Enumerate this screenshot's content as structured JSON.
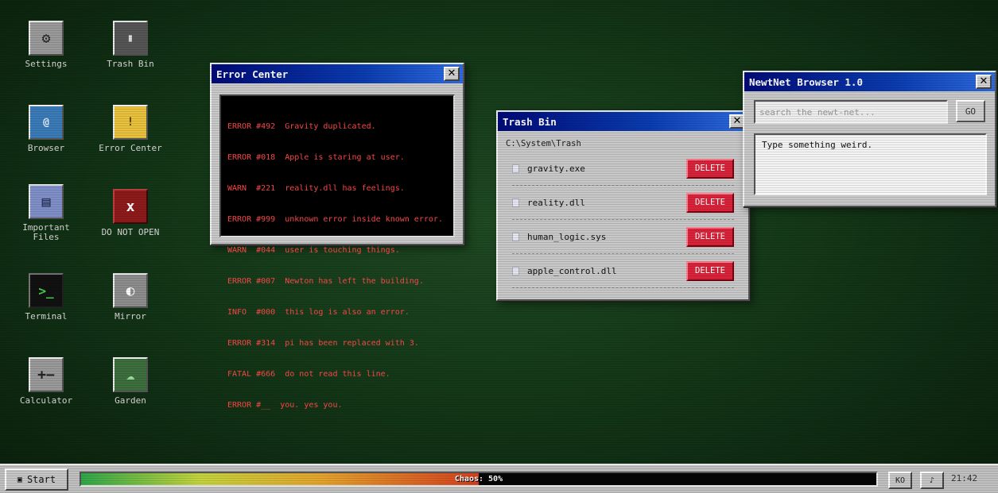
{
  "desktop": {
    "icons": [
      {
        "label": "Settings",
        "glyph": "⚙",
        "icon": "gear-icon"
      },
      {
        "label": "Trash Bin",
        "glyph": "🗑",
        "icon": "trash-icon"
      },
      {
        "label": "Browser",
        "glyph": "@",
        "icon": "at-icon"
      },
      {
        "label": "Error Center",
        "glyph": "!",
        "icon": "warning-icon"
      },
      {
        "label": "Important Files",
        "glyph": "▤",
        "icon": "files-icon"
      },
      {
        "label": "DO NOT OPEN",
        "glyph": "x",
        "icon": "danger-icon"
      },
      {
        "label": "Terminal",
        "glyph": ">_",
        "icon": "terminal-icon"
      },
      {
        "label": "Mirror",
        "glyph": "◐",
        "icon": "mirror-icon"
      },
      {
        "label": "Calculator",
        "glyph": "+−",
        "icon": "calculator-icon"
      },
      {
        "label": "Garden",
        "glyph": "☁",
        "icon": "tree-icon"
      }
    ]
  },
  "error_center": {
    "title": "Error Center",
    "close": "✕",
    "log": [
      "ERROR #492  Gravity duplicated.",
      "ERROR #018  Apple is staring at user.",
      "WARN  #221  reality.dll has feelings.",
      "ERROR #999  unknown error inside known error.",
      "WARN  #044  user is touching things.",
      "ERROR #007  Newton has left the building.",
      "INFO  #000  this log is also an error.",
      "ERROR #314  pi has been replaced with 3.",
      "FATAL #666  do not read this line.",
      "ERROR #__  you. yes you."
    ]
  },
  "trash_bin": {
    "title": "Trash Bin",
    "close": "✕",
    "path": "C:\\System\\Trash",
    "files": [
      {
        "name": "gravity.exe",
        "action": "DELETE"
      },
      {
        "name": "reality.dll",
        "action": "DELETE"
      },
      {
        "name": "human_logic.sys",
        "action": "DELETE"
      },
      {
        "name": "apple_control.dll",
        "action": "DELETE"
      }
    ]
  },
  "browser": {
    "title": "NewtNet Browser 1.0",
    "close": "✕",
    "search_placeholder": "search the newt-net...",
    "go_label": "GO",
    "body_text": "Type something weird."
  },
  "taskbar": {
    "start_label": "Start",
    "start_glyph": "▣",
    "chaos_label": "Chaos: 50%",
    "chaos_fraction": 0.5,
    "lang_label": "KO",
    "music_glyph": "♪",
    "clock": "21:42"
  }
}
